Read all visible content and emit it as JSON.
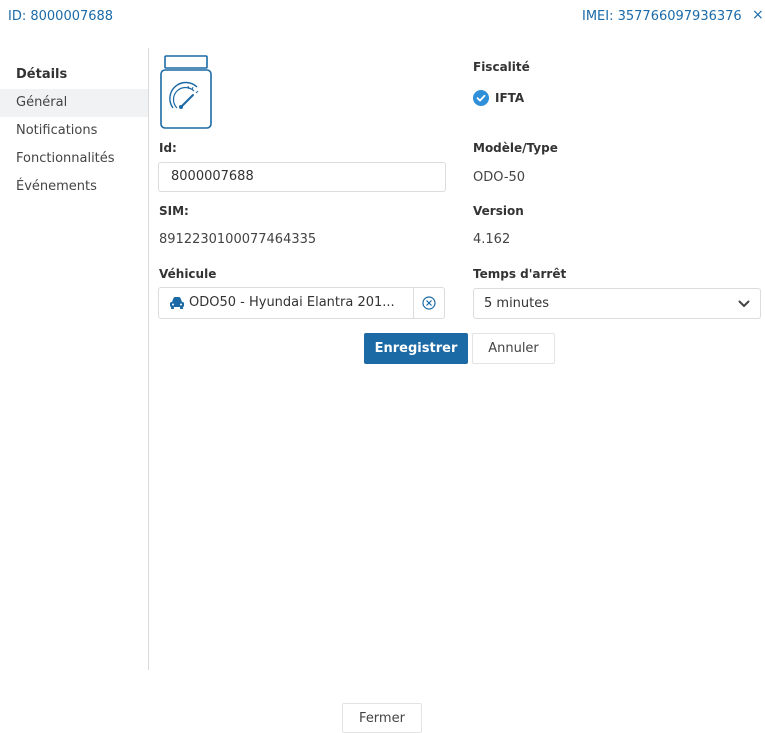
{
  "header": {
    "id_text": "ID: 8000007688",
    "imei_text": "IMEI: 357766097936376",
    "close_glyph": "×"
  },
  "sidebar": {
    "title": "Détails",
    "items": [
      {
        "label": "Général",
        "active": true
      },
      {
        "label": "Notifications",
        "active": false
      },
      {
        "label": "Fonctionnalités",
        "active": false
      },
      {
        "label": "Événements",
        "active": false
      }
    ]
  },
  "device": {
    "icon": "odometer-device-icon",
    "id_label": "Id:",
    "id_value": "8000007688",
    "sim_label": "SIM:",
    "sim_value": "8912230100077464335",
    "vehicle_label": "Véhicule",
    "vehicle_value": "ODO50 - Hyundai Elantra 201...",
    "vehicle_icon": "car-icon",
    "clear_icon": "clear-circle-icon"
  },
  "right": {
    "fiscal_label": "Fiscalité",
    "ifta_label": "IFTA",
    "ifta_checked": true,
    "model_label": "Modèle/Type",
    "model_value": "ODO-50",
    "version_label": "Version",
    "version_value": "4.162",
    "stop_label": "Temps d'arrêt",
    "stop_value": "5 minutes"
  },
  "actions": {
    "save_label": "Enregistrer",
    "cancel_label": "Annuler",
    "close_label": "Fermer"
  },
  "colors": {
    "accent": "#1b6aa5",
    "link": "#1c6aa8",
    "active_bg": "#f0f2f4",
    "check": "#2f8fd8"
  }
}
